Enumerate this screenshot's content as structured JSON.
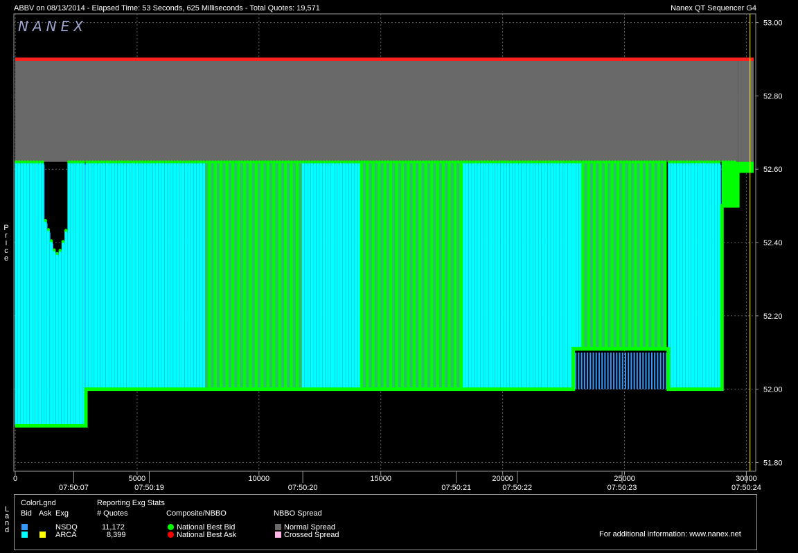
{
  "header": {
    "left_title": "ABBV on 08/13/2014  -  Elapsed Time: 53 Seconds, 625 Milliseconds  -  Total Quotes: 19,571",
    "right_title": "Nanex QT Sequencer G4",
    "watermark": "NANEX"
  },
  "chart_data": {
    "type": "line",
    "ylabel": "Price",
    "ylim": [
      51.78,
      53.02
    ],
    "xlim": [
      0,
      30300
    ],
    "y_ticks": [
      "53.00",
      "52.80",
      "52.60",
      "52.40",
      "52.20",
      "52.00",
      "51.80"
    ],
    "y_tick_values": [
      53.0,
      52.8,
      52.6,
      52.4,
      52.2,
      52.0,
      51.8
    ],
    "x_ticks": [
      "0",
      "5000",
      "10000",
      "15000",
      "20000",
      "25000",
      "30000"
    ],
    "x_tick_values": [
      0,
      5000,
      10000,
      15000,
      20000,
      25000,
      30000
    ],
    "time_ticks": [
      "07:50:07",
      "07:50:19",
      "07:50:20",
      "07:50:21",
      "07:50:22",
      "07:50:23",
      "07:50:24"
    ],
    "time_tick_values": [
      2400,
      5500,
      11800,
      18100,
      20600,
      24900,
      30000
    ],
    "grid": true,
    "series": [
      {
        "name": "National Best Ask",
        "color": "#ff2020",
        "x": [
          0,
          30300
        ],
        "y": [
          52.9,
          52.9
        ]
      },
      {
        "name": "National Best Bid",
        "color": "#00ff00",
        "x": [
          0,
          2900,
          2900,
          22900,
          22900,
          26800,
          26800,
          29000,
          29000,
          29650,
          29650,
          30300
        ],
        "y": [
          51.9,
          51.9,
          52.0,
          52.0,
          52.11,
          52.11,
          52.0,
          52.0,
          52.5,
          52.5,
          52.6,
          52.6
        ]
      }
    ],
    "quote_bands": [
      {
        "x0": 0,
        "x1": 2900,
        "low": 51.9,
        "high": 52.62
      },
      {
        "x0": 2900,
        "x1": 22900,
        "low": 52.0,
        "high": 52.62
      },
      {
        "x0": 22900,
        "x1": 26800,
        "low": 52.11,
        "high": 52.62
      },
      {
        "x0": 26800,
        "x1": 29000,
        "low": 52.0,
        "high": 52.62
      },
      {
        "x0": 29000,
        "x1": 29650,
        "low": 52.5,
        "high": 52.62
      }
    ],
    "dense_ranges": [
      [
        7800,
        11700
      ],
      [
        14200,
        18400
      ],
      [
        23300,
        26800
      ]
    ]
  },
  "legend": {
    "side_label": "Land",
    "colorlgnd": "ColorLgnd",
    "bid_h": "Bid",
    "ask_h": "Ask",
    "exg_h": "Exg",
    "reporting": "Reporting Exg Stats",
    "quotes_h": "# Quotes",
    "composite_h": "Composite/NBBO",
    "spread_h": "NBBO Spread",
    "rows": [
      {
        "exg": "NSDQ",
        "count": "11,172",
        "bid_color": "#3399ff",
        "ask_color": ""
      },
      {
        "exg": "ARCA",
        "count": "8,399",
        "bid_color": "#00ffff",
        "ask_color": "#ffff00"
      }
    ],
    "nbb": "National Best Bid",
    "nbb_color": "#00ff00",
    "nba": "National Best Ask",
    "nba_color": "#ff0000",
    "normal_spread": "Normal Spread",
    "normal_spread_color": "#696969",
    "crossed_spread": "Crossed Spread",
    "crossed_spread_color": "#ffb6e6",
    "info": "For additional information: www.nanex.net"
  }
}
